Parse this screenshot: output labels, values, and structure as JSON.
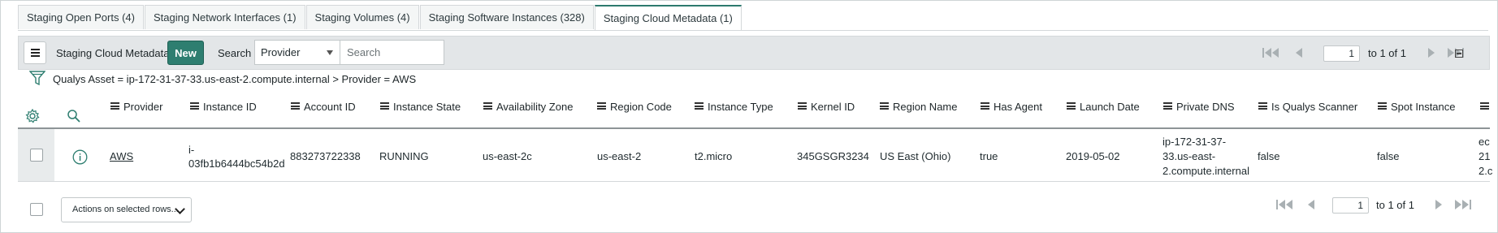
{
  "tabs": [
    {
      "label": "Staging Open Ports (4)"
    },
    {
      "label": "Staging Network Interfaces (1)"
    },
    {
      "label": "Staging Volumes (4)"
    },
    {
      "label": "Staging Software Instances (328)"
    },
    {
      "label": "Staging Cloud Metadata (1)",
      "active": true
    }
  ],
  "toolbar": {
    "list_title": "Staging Cloud Metadata",
    "new_label": "New",
    "search_label": "Search",
    "search_field": "Provider",
    "search_placeholder": "Search",
    "page_number": "1",
    "page_of": "to 1 of 1"
  },
  "breadcrumb": {
    "text": "Qualys Asset = ip-172-31-37-33.us-east-2.compute.internal  >  Provider = AWS"
  },
  "columns": [
    "Provider",
    "Instance ID",
    "Account ID",
    "Instance State",
    "Availability Zone",
    "Region Code",
    "Instance Type",
    "Kernel ID",
    "Region Name",
    "Has Agent",
    "Launch Date",
    "Private DNS",
    "Is Qualys Scanner",
    "Spot Instance"
  ],
  "rows": [
    {
      "provider": "AWS",
      "instance_id_1": "i-",
      "instance_id_2": "03fb1b6444bc54b2d",
      "account_id": "883273722338",
      "instance_state": "RUNNING",
      "availability_zone": "us-east-2c",
      "region_code": "us-east-2",
      "instance_type": "t2.micro",
      "kernel_id": "345GSGR3234",
      "region_name": "US East (Ohio)",
      "has_agent": "true",
      "launch_date": "2019-05-02",
      "private_dns_1": "ip-172-31-37-",
      "private_dns_2": "33.us-east-",
      "private_dns_3": "2.compute.internal",
      "is_qualys_scanner": "false",
      "spot_instance": "false",
      "clip_1": "ec",
      "clip_2": "21",
      "clip_3": "2.c"
    }
  ],
  "footer": {
    "actions_label": "Actions on selected rows...",
    "page_number": "1",
    "page_of": "to 1 of 1"
  },
  "colors": {
    "accent": "#2e7e70",
    "toolbar_bg": "#e3e6e8"
  },
  "icons": [
    "menu-icon",
    "filter-icon",
    "gear-icon",
    "search-icon",
    "info-icon",
    "first-page-icon",
    "prev-page-icon",
    "next-page-icon",
    "last-page-icon",
    "collapse-icon"
  ]
}
